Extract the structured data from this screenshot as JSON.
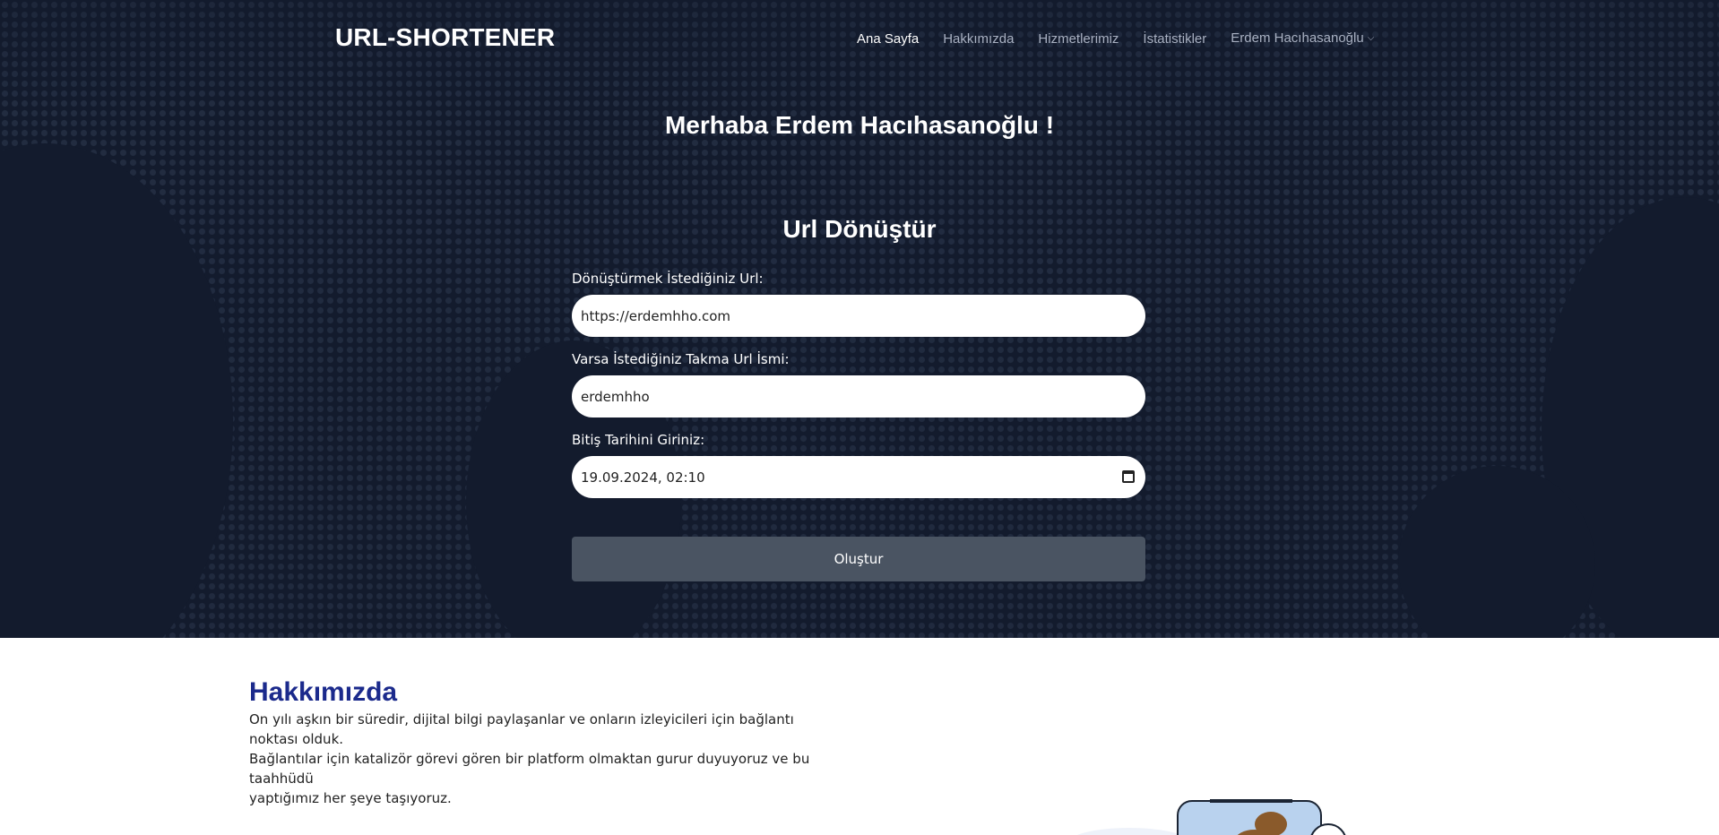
{
  "brand": "URL-SHORTENER",
  "nav": {
    "items": [
      {
        "label": "Ana Sayfa",
        "active": true
      },
      {
        "label": "Hakkımızda",
        "active": false
      },
      {
        "label": "Hizmetlerimiz",
        "active": false
      },
      {
        "label": "İstatistikler",
        "active": false
      },
      {
        "label": "Erdem Hacıhasanoğlu",
        "active": false
      }
    ]
  },
  "hero": {
    "greeting": "Merhaba Erdem Hacıhasanoğlu !",
    "form_title": "Url Dönüştür"
  },
  "form": {
    "url_label": "Dönüştürmek İstediğiniz Url:",
    "url_value": "https://erdemhho.com",
    "alias_label": "Varsa İstediğiniz Takma Url İsmi:",
    "alias_value": "erdemhho",
    "date_label": "Bitiş Tarihini Giriniz:",
    "date_value": "19.09.2024, 02:10",
    "submit_label": "Oluştur"
  },
  "about": {
    "title": "Hakkımızda",
    "lines": [
      "On yılı aşkın bir süredir, dijital bilgi paylaşanlar ve onların izleyicileri için bağlantı noktası olduk.",
      "Bağlantılar için katalizör görevi gören bir platform olmaktan gurur duyuyoruz ve bu taahhüdü",
      "yaptığımız her şeye taşıyoruz."
    ]
  },
  "colors": {
    "hero_bg": "#131b2d",
    "button_bg": "#4a5462",
    "about_title": "#1b2a8c"
  },
  "icons": [
    "chevron-down-icon",
    "calendar-icon"
  ]
}
